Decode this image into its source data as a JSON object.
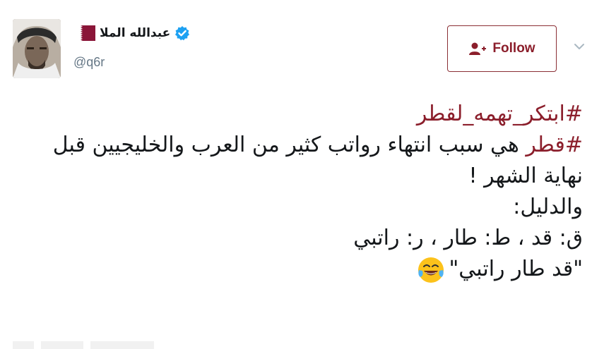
{
  "user": {
    "display_name": "عبدالله الملا",
    "handle": "@q6r",
    "verified": true
  },
  "header": {
    "follow_label": "Follow"
  },
  "tweet": {
    "hashtag_line": "#ابتكر_تهمه_لقطر",
    "line2_hashtag": "#قطر",
    "line2_text": " هي سبب انتهاء رواتب كثير من العرب والخليجيين قبل",
    "line3": "نهاية الشهر !",
    "line4": "والدليل:",
    "line5": "ق: قد ، ط: طار ، ر: راتبي",
    "line6": "\"قد طار راتبي\"",
    "emoji": "face-with-tears-of-joy-icon"
  },
  "colors": {
    "accent": "#8b1e2b",
    "text": "#14171a",
    "secondary": "#657786",
    "verified": "#1da1f2",
    "flag_maroon": "#8a1538"
  }
}
